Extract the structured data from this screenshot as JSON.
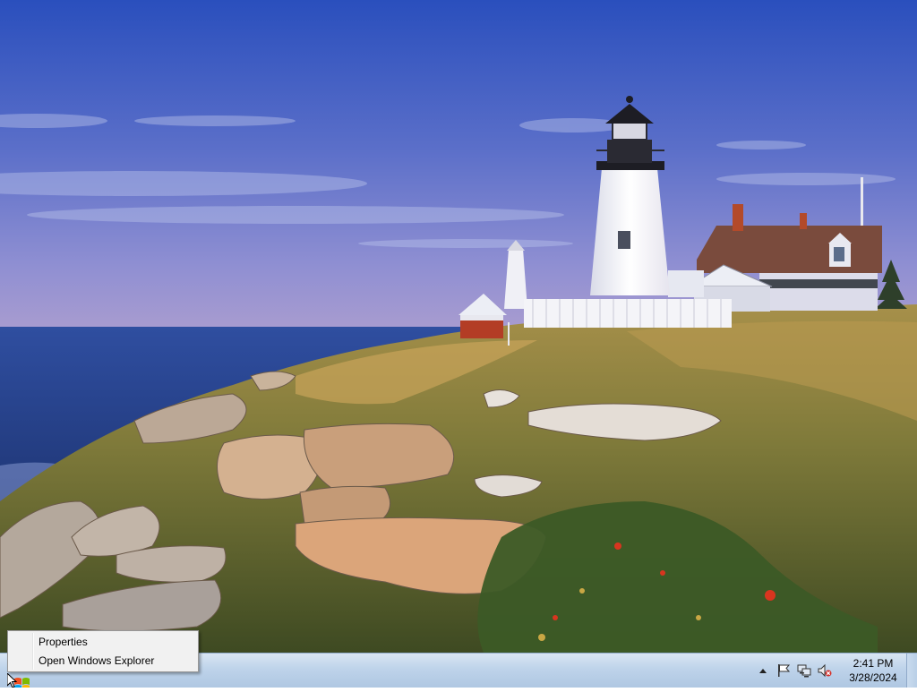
{
  "context_menu": {
    "items": [
      {
        "label": "Properties"
      },
      {
        "label": "Open Windows Explorer"
      }
    ]
  },
  "taskbar": {
    "start_button_icon": "windows-logo-icon",
    "tray": {
      "icons": [
        "show-hidden-icons-icon",
        "action-center-flag-icon",
        "network-icon",
        "volume-muted-icon"
      ],
      "time": "2:41 PM",
      "date": "3/28/2024"
    }
  },
  "colors": {
    "taskbar_top": "#d9e6f3",
    "taskbar_bottom": "#afc7e2",
    "menu_background": "#f1f1f1",
    "sky_top": "#2a4fbd",
    "sea": "#263f8c"
  }
}
